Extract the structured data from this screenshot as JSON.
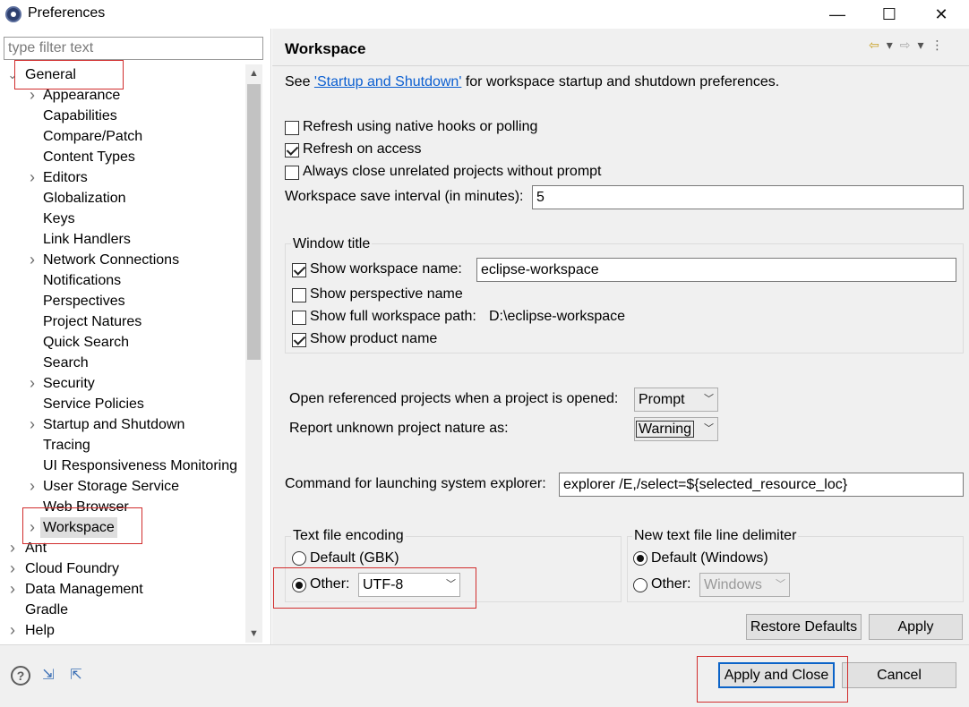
{
  "window": {
    "title": "Preferences",
    "minimize": "—",
    "maximize": "☐",
    "close": "✕"
  },
  "filter": {
    "placeholder": "type filter text"
  },
  "tree": {
    "items": [
      {
        "label": "General",
        "level": 0,
        "arrow": "expanded"
      },
      {
        "label": "Appearance",
        "level": 1,
        "arrow": "collapsed"
      },
      {
        "label": "Capabilities",
        "level": 1,
        "arrow": ""
      },
      {
        "label": "Compare/Patch",
        "level": 1,
        "arrow": ""
      },
      {
        "label": "Content Types",
        "level": 1,
        "arrow": ""
      },
      {
        "label": "Editors",
        "level": 1,
        "arrow": "collapsed"
      },
      {
        "label": "Globalization",
        "level": 1,
        "arrow": ""
      },
      {
        "label": "Keys",
        "level": 1,
        "arrow": ""
      },
      {
        "label": "Link Handlers",
        "level": 1,
        "arrow": ""
      },
      {
        "label": "Network Connections",
        "level": 1,
        "arrow": "collapsed"
      },
      {
        "label": "Notifications",
        "level": 1,
        "arrow": ""
      },
      {
        "label": "Perspectives",
        "level": 1,
        "arrow": ""
      },
      {
        "label": "Project Natures",
        "level": 1,
        "arrow": ""
      },
      {
        "label": "Quick Search",
        "level": 1,
        "arrow": ""
      },
      {
        "label": "Search",
        "level": 1,
        "arrow": ""
      },
      {
        "label": "Security",
        "level": 1,
        "arrow": "collapsed"
      },
      {
        "label": "Service Policies",
        "level": 1,
        "arrow": ""
      },
      {
        "label": "Startup and Shutdown",
        "level": 1,
        "arrow": "collapsed"
      },
      {
        "label": "Tracing",
        "level": 1,
        "arrow": ""
      },
      {
        "label": "UI Responsiveness Monitoring",
        "level": 1,
        "arrow": ""
      },
      {
        "label": "User Storage Service",
        "level": 1,
        "arrow": "collapsed"
      },
      {
        "label": "Web Browser",
        "level": 1,
        "arrow": ""
      },
      {
        "label": "Workspace",
        "level": 1,
        "arrow": "collapsed",
        "selected": true
      },
      {
        "label": "Ant",
        "level": 0,
        "arrow": "collapsed"
      },
      {
        "label": "Cloud Foundry",
        "level": 0,
        "arrow": "collapsed"
      },
      {
        "label": "Data Management",
        "level": 0,
        "arrow": "collapsed"
      },
      {
        "label": "Gradle",
        "level": 0,
        "arrow": ""
      },
      {
        "label": "Help",
        "level": 0,
        "arrow": "collapsed"
      }
    ]
  },
  "page": {
    "title": "Workspace",
    "see_prefix": "See ",
    "see_link": "'Startup and Shutdown'",
    "see_suffix": " for workspace startup and shutdown preferences.",
    "refresh_native": {
      "label": "Refresh using native hooks or polling",
      "checked": false
    },
    "refresh_access": {
      "label": "Refresh on access",
      "checked": true
    },
    "always_close": {
      "label": "Always close unrelated projects without prompt",
      "checked": false
    },
    "save_interval_label": "Workspace save interval (in minutes):",
    "save_interval_value": "5",
    "window_title_group": "Window title",
    "show_workspace_name": {
      "label": "Show workspace name:",
      "checked": true
    },
    "workspace_name_value": "eclipse-workspace",
    "show_perspective_name": {
      "label": "Show perspective name",
      "checked": false
    },
    "show_full_path": {
      "label": "Show full workspace path:",
      "checked": false
    },
    "full_path_value": "D:\\eclipse-workspace",
    "show_product_name": {
      "label": "Show product name",
      "checked": true
    },
    "open_referenced_label": "Open referenced projects when a project is opened:",
    "open_referenced_value": "Prompt",
    "report_unknown_label": "Report unknown project nature as:",
    "report_unknown_value": "Warning",
    "explorer_label": "Command for launching system explorer:",
    "explorer_value": "explorer /E,/select=${selected_resource_loc}",
    "encoding_group": "Text file encoding",
    "encoding_default": {
      "label": "Default (GBK)",
      "checked": false
    },
    "encoding_other": {
      "label": "Other:",
      "checked": true
    },
    "encoding_other_value": "UTF-8",
    "delimiter_group": "New text file line delimiter",
    "delimiter_default": {
      "label": "Default (Windows)",
      "checked": true
    },
    "delimiter_other": {
      "label": "Other:",
      "checked": false
    },
    "delimiter_other_value": "Windows",
    "restore_defaults": "Restore Defaults",
    "apply": "Apply"
  },
  "footer": {
    "apply_and_close": "Apply and Close",
    "cancel": "Cancel"
  },
  "icons": {
    "help": "?",
    "import": "⇲",
    "export": "⇱",
    "back": "⇦",
    "forward": "⇨",
    "dropdown": "▾",
    "menu": "⋮"
  },
  "colors": {
    "annotation": "#d12d2d",
    "link": "#0b5fd1",
    "focus": "#0b63c8"
  }
}
